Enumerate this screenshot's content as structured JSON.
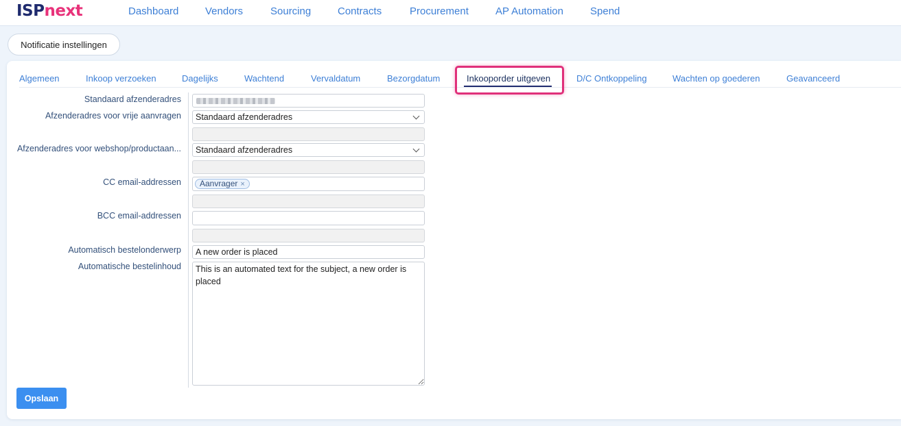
{
  "logo": {
    "part1": "ISP",
    "part2": "next"
  },
  "nav": [
    "Dashboard",
    "Vendors",
    "Sourcing",
    "Contracts",
    "Procurement",
    "AP Automation",
    "Spend"
  ],
  "notification_button": "Notificatie instellingen",
  "tabs": [
    "Algemeen",
    "Inkoop verzoeken",
    "Dagelijks",
    "Wachtend",
    "Vervaldatum",
    "Bezorgdatum",
    "Inkooporder uitgeven",
    "D/C Ontkoppeling",
    "Wachten op goederen",
    "Geavanceerd"
  ],
  "active_tab": "Inkooporder uitgeven",
  "form": {
    "default_sender_label": "Standaard afzenderadres",
    "free_sender_label": "Afzenderadres voor vrije aanvragen",
    "free_sender_value": "Standaard afzenderadres",
    "webshop_sender_label": "Afzenderadres voor webshop/productaan...",
    "webshop_sender_value": "Standaard afzenderadres",
    "cc_label": "CC email-addressen",
    "cc_chip": "Aanvrager",
    "cc_chip_remove": "×",
    "bcc_label": "BCC email-addressen",
    "subject_label": "Automatisch bestelonderwerp",
    "subject_value": "A new order is placed",
    "content_label": "Automatische bestelinhoud",
    "content_value": "This is an automated text for the subject, a new order is placed"
  },
  "save_button": "Opslaan",
  "colors": {
    "accent": "#3b8ff0",
    "highlight": "#e0307a",
    "brand_dark": "#1f2b6e",
    "brand_pink": "#e8327a"
  }
}
